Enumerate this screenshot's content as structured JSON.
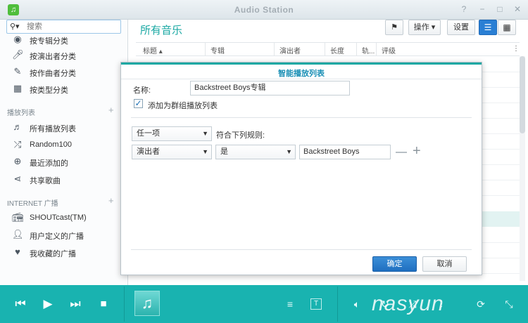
{
  "window": {
    "title": "Audio Station",
    "controls": [
      "?",
      "−",
      "□",
      "✕"
    ]
  },
  "sidebar": {
    "search_placeholder": "搜索",
    "items_top": [
      {
        "label": "按专辑分类",
        "icon": "disc-icon"
      },
      {
        "label": "按演出者分类",
        "icon": "microphone-icon"
      },
      {
        "label": "按作曲者分类",
        "icon": "pen-icon"
      },
      {
        "label": "按类型分类",
        "icon": "grid-icon"
      }
    ],
    "playlist_section": "播放列表",
    "playlist_items": [
      {
        "label": "所有播放列表",
        "icon": "playlist-icon"
      },
      {
        "label": "Random100",
        "icon": "shuffle-icon"
      },
      {
        "label": "最近添加的",
        "icon": "add-circle-icon"
      },
      {
        "label": "共享歌曲",
        "icon": "share-icon"
      }
    ],
    "radio_section": "INTERNET 广播",
    "radio_items": [
      {
        "label": "SHOUTcast(TM)",
        "icon": "radio-icon"
      },
      {
        "label": "用户定义的广播",
        "icon": "user-icon"
      },
      {
        "label": "我收藏的广播",
        "icon": "heart-icon"
      }
    ]
  },
  "main": {
    "title": "所有音乐",
    "toolbar": {
      "action_label": "操作",
      "settings_label": "设置"
    },
    "columns": [
      "标题",
      "专辑",
      "演出者",
      "长度",
      "轨...",
      "评级"
    ]
  },
  "dialog": {
    "title": "智能播放列表",
    "name_label": "名称:",
    "name_value": "Backstreet Boys专辑",
    "checkbox_label": "添加为群组播放列表",
    "checkbox_checked": true,
    "match_option": "任一项",
    "match_suffix": "符合下列规则:",
    "rule": {
      "field": "演出者",
      "operator": "是",
      "value": "Backstreet Boys"
    },
    "ok_label": "确定",
    "cancel_label": "取消"
  },
  "player": {
    "accent": "#19b3b0",
    "watermark": "nasyun"
  }
}
